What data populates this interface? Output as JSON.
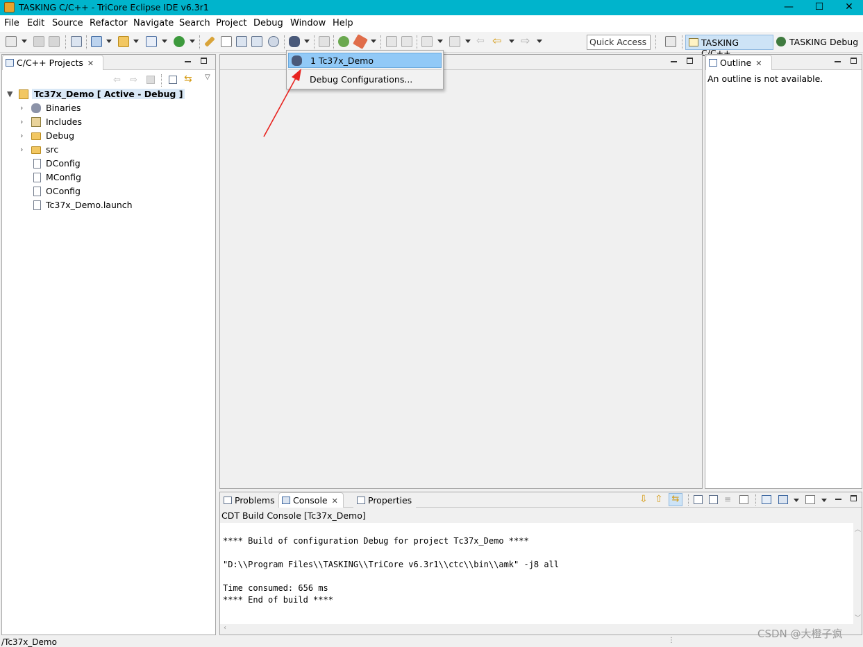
{
  "window": {
    "title": "TASKING C/C++ - TriCore Eclipse IDE v6.3r1",
    "controls": {
      "minimize": "—",
      "maximize": "☐",
      "close": "✕"
    }
  },
  "menubar": [
    "File",
    "Edit",
    "Source",
    "Refactor",
    "Navigate",
    "Search",
    "Project",
    "Debug",
    "Window",
    "Help"
  ],
  "toolbar": {
    "quick_access": "Quick Access",
    "perspectives": [
      "TASKING C/C++",
      "TASKING Debug"
    ]
  },
  "project_explorer": {
    "tab_label": "C/C++ Projects",
    "project": "Tc37x_Demo [ Active - Debug ]",
    "items": [
      "Binaries",
      "Includes",
      "Debug",
      "src",
      "DConfig",
      "MConfig",
      "OConfig",
      "Tc37x_Demo.launch"
    ]
  },
  "debug_dropdown": {
    "items": [
      "1 Tc37x_Demo",
      "Debug Configurations..."
    ]
  },
  "outline": {
    "tab_label": "Outline",
    "message": "An outline is not available."
  },
  "bottom_panel": {
    "tabs": [
      "Problems",
      "Console",
      "Properties"
    ],
    "console_title": "CDT Build Console [Tc37x_Demo]",
    "lines": [
      "**** Build of configuration Debug for project Tc37x_Demo ****",
      "\"D:\\\\Program Files\\\\TASKING\\\\TriCore v6.3r1\\\\ctc\\\\bin\\\\amk\" -j8 all",
      "Time consumed: 656 ms",
      "**** End of build ****"
    ]
  },
  "status": {
    "path": "/Tc37x_Demo"
  },
  "watermark": "CSDN @大橙子疯",
  "colors": {
    "titlebar": "#00b4cc",
    "selection": "#91c9f7",
    "annotation_arrow": "#e8231f"
  }
}
